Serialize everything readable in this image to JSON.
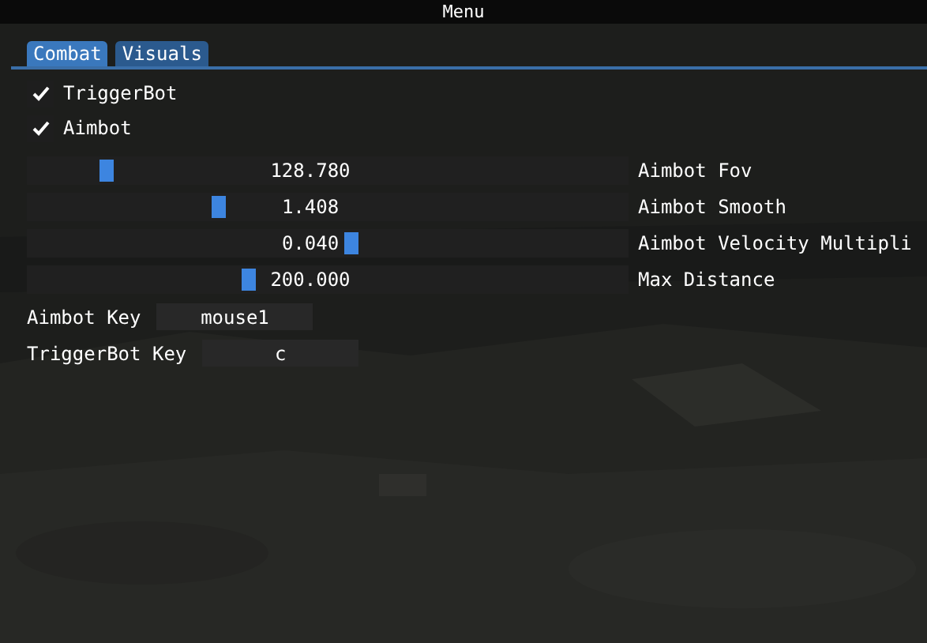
{
  "window": {
    "title": "Menu"
  },
  "tabs": [
    {
      "label": "Combat",
      "selected": true
    },
    {
      "label": "Visuals",
      "selected": false
    }
  ],
  "checkboxes": [
    {
      "label": "TriggerBot",
      "checked": true
    },
    {
      "label": "Aimbot",
      "checked": true
    }
  ],
  "sliders": [
    {
      "value": "128.780",
      "label": "Aimbot Fov",
      "level": 0.124
    },
    {
      "value": "1.408",
      "label": "Aimbot Smooth",
      "level": 0.315
    },
    {
      "value": "0.040",
      "label": "Aimbot Velocity Multipli",
      "level": 0.54
    },
    {
      "value": "200.000",
      "label": "Max Distance",
      "level": 0.365
    }
  ],
  "keys": [
    {
      "label": "Aimbot Key",
      "value": "mouse1"
    },
    {
      "label": "TriggerBot Key",
      "value": "c"
    }
  ]
}
